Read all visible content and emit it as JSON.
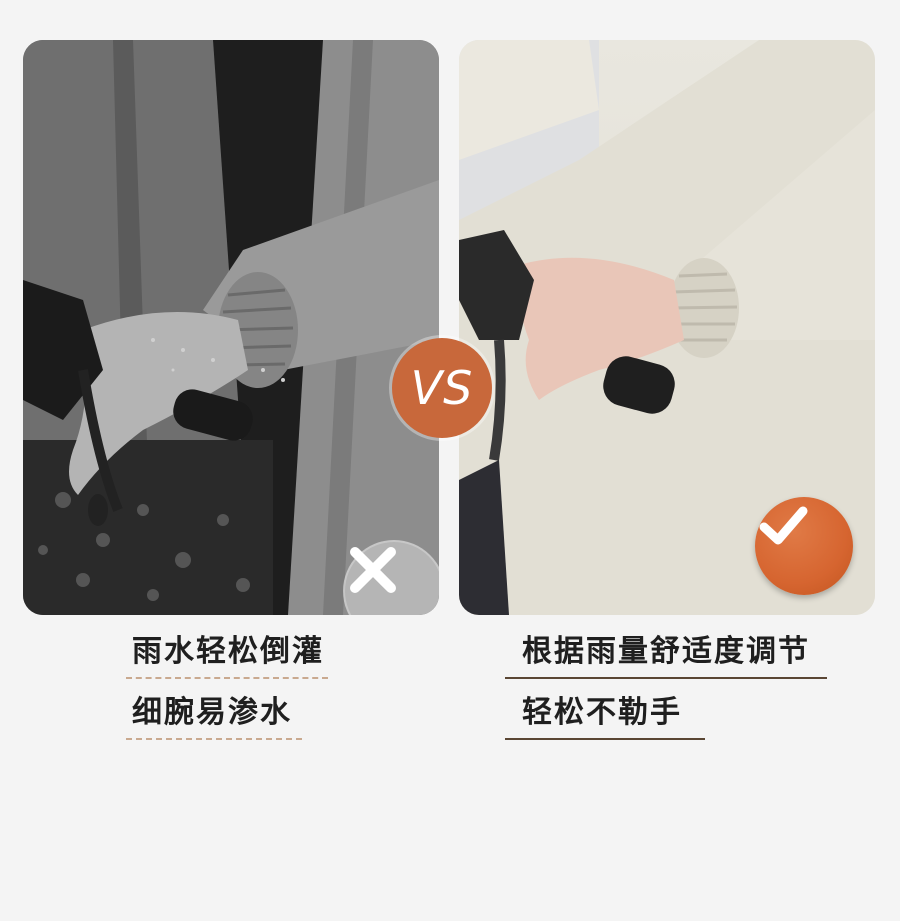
{
  "comparison": {
    "vs_label": "VS",
    "left": {
      "mark_icon": "cross-icon",
      "captions": [
        "雨水轻松倒灌",
        "细腕易渗水"
      ]
    },
    "right": {
      "mark_icon": "check-icon",
      "captions": [
        "根据雨量舒适度调节",
        "轻松不勒手"
      ]
    }
  },
  "colors": {
    "background": "#f4f4f4",
    "accent": "#c8683b",
    "left_underline": "#c9a98f",
    "right_underline": "#5a4634",
    "caption_text": "#1f1f1f"
  }
}
